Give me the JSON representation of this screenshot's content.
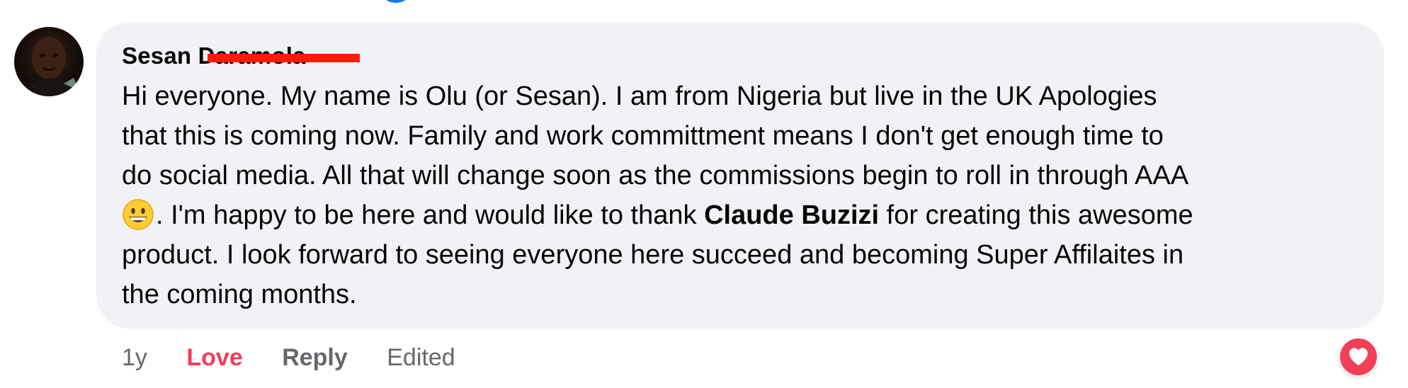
{
  "comment": {
    "author_first": "Sesan",
    "author_surname": "Daramola",
    "lines": [
      "Hi everyone. My name is Olu (or Sesan). I am from Nigeria but live in the UK Apologies",
      "that this is coming now. Family and work committment means I don't get enough time to",
      "do social media. All that will change soon as the commissions begin to roll in through AAA"
    ],
    "line4_before_mention": ". I'm happy to be here and would like to thank ",
    "mention": "Claude Buzizi",
    "line4_after_mention": " for creating this awesome",
    "lines_end": [
      "product. I look forward to seeing everyone here succeed and becoming Super Affilaites in",
      "the coming months."
    ],
    "emoji_icon": "grinning-face-emoji"
  },
  "actions": {
    "timestamp": "1y",
    "love": "Love",
    "reply": "Reply",
    "edited": "Edited"
  },
  "reaction": {
    "icon": "heart-icon",
    "color": "#f33e58"
  },
  "colors": {
    "bubble": "#f0f2f5",
    "secondary_text": "#65676b",
    "redaction": "#ff1a0a"
  }
}
